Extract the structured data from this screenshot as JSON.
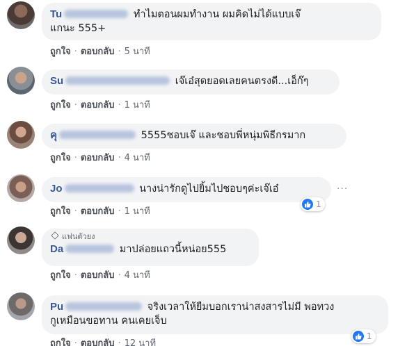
{
  "comments": [
    {
      "author_visible": "Tu",
      "text_line1": "ทำไมตอนผมทำงาน ผมคิดไม่ได้แบบเจ๊",
      "text_line2": "แกนะ 555+",
      "like": "ถูกใจ",
      "reply": "ตอบกลับ",
      "time": "5 นาที"
    },
    {
      "author_visible": "Su",
      "text": "เจ๊เอ๋สุดยอดเลยคนตรงดี...เอ็ก๊ๆ",
      "like": "ถูกใจ",
      "reply": "ตอบกลับ",
      "time": "1 นาที"
    },
    {
      "author_visible": "คุ",
      "text": "5555ชอบเจ๊ และชอบพี่หนุ่มพิธีกรมาก",
      "like": "ถูกใจ",
      "reply": "ตอบกลับ",
      "time": "4 นาที"
    },
    {
      "author_visible": "Jo",
      "text": "นางน่ารักดูไปยิ้มไปชอบๆค่ะเจ๊เอ๋",
      "like": "ถูกใจ",
      "reply": "ตอบกลับ",
      "time": "1 นาที",
      "reaction_count": "1"
    },
    {
      "badge": "แฟนตัวยง",
      "author_visible": "Da",
      "text": "มาปล่อยแถวนี้หน่อย555",
      "like": "ถูกใจ",
      "reply": "ตอบกลับ",
      "time": "4 นาที"
    },
    {
      "author_visible": "Pu",
      "text_line1": "จริงเวลาให้ยืมบอกเราน่าสงสารไม่มี พอทวง",
      "text_line2": "กูเหมือนขอทาน คนเคยเจ็บ",
      "like": "ถูกใจ",
      "reply": "ตอบกลับ",
      "time": "12 นาที",
      "reaction_count": "1"
    }
  ],
  "colors": {
    "author": "#385898",
    "bubble": "#f2f3f5",
    "meta": "#606770",
    "like_blue": "#2078f4"
  }
}
